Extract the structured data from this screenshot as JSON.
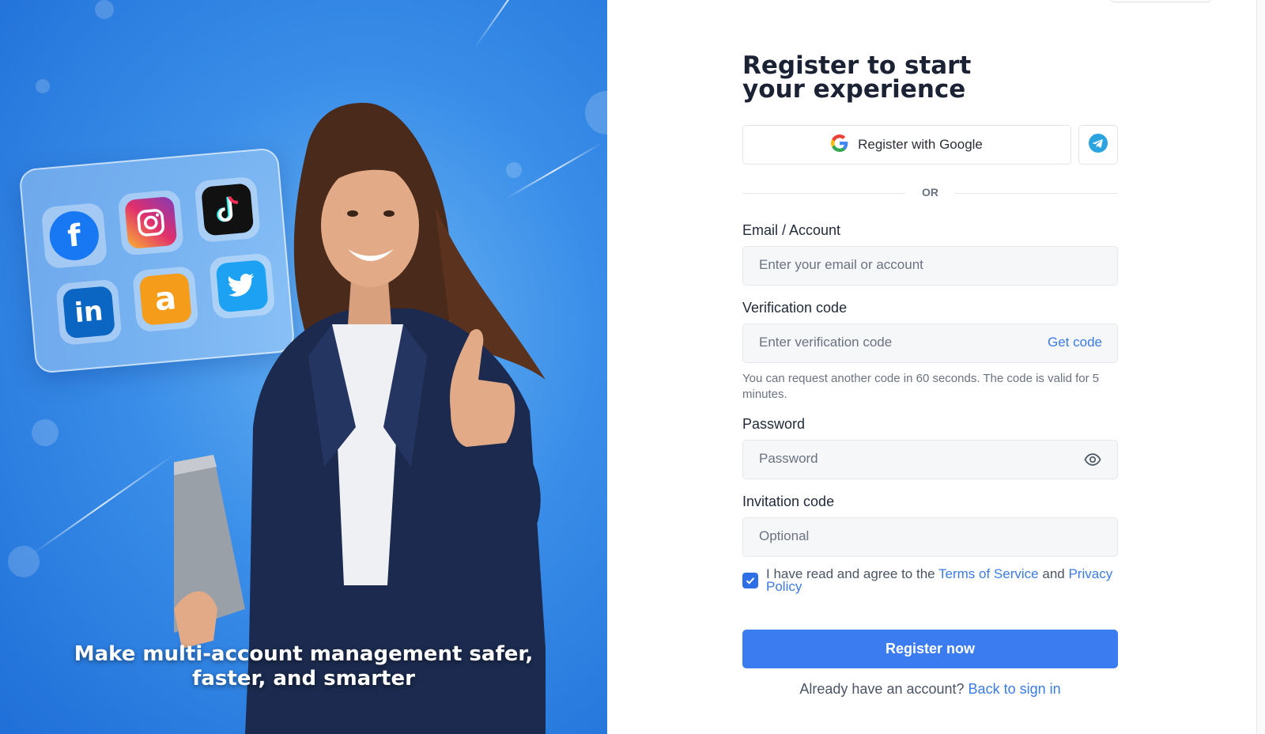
{
  "hero": {
    "caption_line1": "Make multi-account management safer,",
    "caption_line2": "faster, and smarter",
    "app_icons": [
      "facebook-icon",
      "instagram-icon",
      "tiktok-icon",
      "linkedin-icon",
      "amazon-icon",
      "twitter-icon"
    ]
  },
  "form": {
    "title": "Register to start your experience",
    "google_label": "Register with Google",
    "divider_text": "OR",
    "email": {
      "label": "Email / Account",
      "placeholder": "Enter your email or account"
    },
    "code": {
      "label": "Verification code",
      "placeholder": "Enter verification code",
      "get_code": "Get code",
      "hint": "You can request another code in 60 seconds. The code is valid for 5 minutes."
    },
    "password": {
      "label": "Password",
      "placeholder": "Password"
    },
    "invite": {
      "label": "Invitation code",
      "placeholder": "Optional"
    },
    "agree": {
      "prefix": "I have read and agree to the",
      "terms": "Terms of Service",
      "and": "and",
      "privacy": "Privacy Policy",
      "checked": true
    },
    "register_label": "Register now",
    "signin_prompt": "Already have an account?",
    "signin_link": "Back to sign in"
  },
  "colors": {
    "primary": "#3b7cf0",
    "link": "#3b7be8",
    "hero_blue": "#2f80e6"
  }
}
